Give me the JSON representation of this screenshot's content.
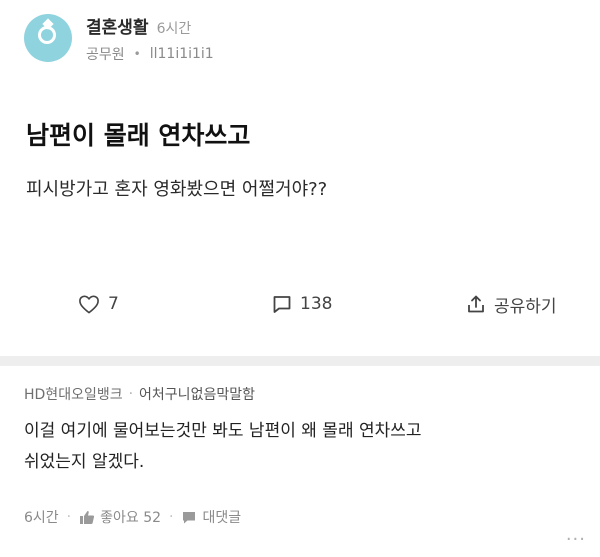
{
  "post": {
    "board": "결혼생활",
    "time": "6시간",
    "author_company": "공무원",
    "author_nick": "ll11i1i1i1",
    "title": "남편이 몰래 연차쓰고",
    "body": "피시방가고 혼자 영화봤으면 어쩔거야??",
    "avatar_icon": "ring-icon",
    "avatar_color": "#8fd3df"
  },
  "actions": {
    "like_count": "7",
    "comment_count": "138",
    "share_label": "공유하기"
  },
  "comment": {
    "company": "HD현대오일뱅크",
    "nick": "어처구니없음막말함",
    "body_line1": "이걸 여기에 물어보는것만 봐도 남편이 왜 몰래 연차쓰고",
    "body_line2": "쉬었는지 알겠다.",
    "time": "6시간",
    "like_label": "좋아요 52",
    "reply_label": "대댓글",
    "more_label": "..."
  }
}
